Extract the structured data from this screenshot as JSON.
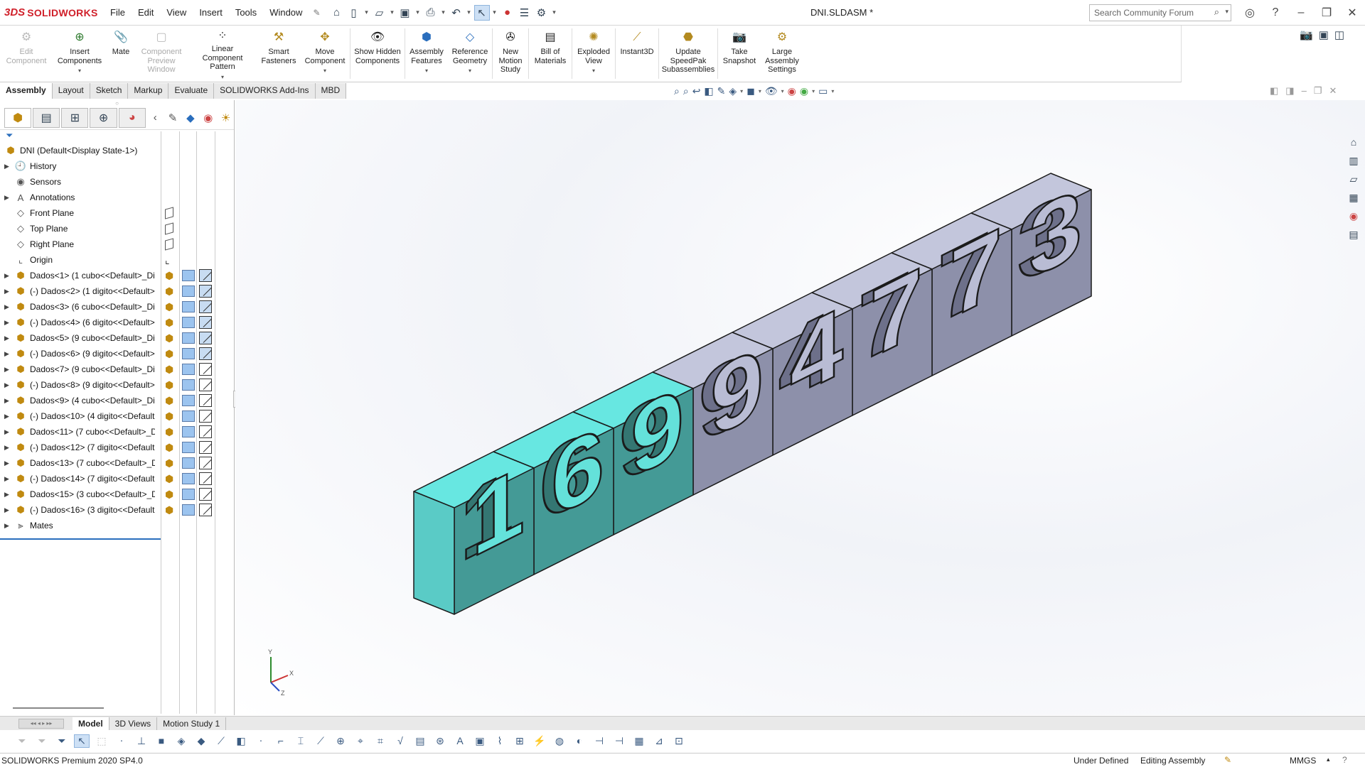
{
  "app": {
    "logo_mark": "3DS",
    "logo_text": "SOLIDWORKS",
    "doc_title": "DNI.SLDASM *",
    "search_placeholder": "Search Community Forum"
  },
  "menu": [
    "File",
    "Edit",
    "View",
    "Insert",
    "Tools",
    "Window"
  ],
  "ribbon": [
    {
      "label": "Edit Component",
      "icon": "edit-component-icon",
      "disabled": true
    },
    {
      "label": "Insert Components",
      "icon": "insert-components-icon",
      "disabled": false,
      "dropdown": true
    },
    {
      "label": "Mate",
      "icon": "mate-icon",
      "disabled": false
    },
    {
      "label": "Component Preview Window",
      "icon": "component-preview-icon",
      "disabled": true
    },
    {
      "label": "Linear Component Pattern",
      "icon": "linear-pattern-icon",
      "disabled": false,
      "dropdown": true
    },
    {
      "label": "Smart Fasteners",
      "icon": "smart-fasteners-icon",
      "disabled": false
    },
    {
      "label": "Move Component",
      "icon": "move-component-icon",
      "disabled": false,
      "dropdown": true
    },
    {
      "label": "Show Hidden Components",
      "icon": "show-hidden-icon",
      "disabled": false
    },
    {
      "label": "Assembly Features",
      "icon": "assembly-features-icon",
      "disabled": false,
      "dropdown": true
    },
    {
      "label": "Reference Geometry",
      "icon": "reference-geometry-icon",
      "disabled": false,
      "dropdown": true
    },
    {
      "label": "New Motion Study",
      "icon": "motion-study-icon",
      "disabled": false
    },
    {
      "label": "Bill of Materials",
      "icon": "bom-icon",
      "disabled": false
    },
    {
      "label": "Exploded View",
      "icon": "exploded-view-icon",
      "disabled": false,
      "dropdown": true
    },
    {
      "label": "Instant3D",
      "icon": "instant3d-icon",
      "disabled": false
    },
    {
      "label": "Update SpeedPak Subassemblies",
      "icon": "speedpak-icon",
      "disabled": false
    },
    {
      "label": "Take Snapshot",
      "icon": "snapshot-icon",
      "disabled": false
    },
    {
      "label": "Large Assembly Settings",
      "icon": "large-assembly-icon",
      "disabled": false
    }
  ],
  "cm_tabs": [
    "Assembly",
    "Layout",
    "Sketch",
    "Markup",
    "Evaluate",
    "SOLIDWORKS Add-Ins",
    "MBD"
  ],
  "cm_active": "Assembly",
  "tree": {
    "root": "DNI  (Default<Display State-1>)",
    "folders": [
      {
        "label": "History",
        "icon": "history-icon",
        "expandable": true
      },
      {
        "label": "Sensors",
        "icon": "sensors-icon",
        "expandable": false
      },
      {
        "label": "Annotations",
        "icon": "annotations-icon",
        "expandable": true
      },
      {
        "label": "Front Plane",
        "icon": "plane-icon",
        "expandable": false
      },
      {
        "label": "Top Plane",
        "icon": "plane-icon",
        "expandable": false
      },
      {
        "label": "Right Plane",
        "icon": "plane-icon",
        "expandable": false
      },
      {
        "label": "Origin",
        "icon": "origin-icon",
        "expandable": false
      }
    ],
    "components": [
      {
        "label": "Dados<1> (1 cubo<<Default>_Di",
        "highlight": true
      },
      {
        "label": "(-) Dados<2> (1 digito<<Default>",
        "highlight": true
      },
      {
        "label": "Dados<3> (6 cubo<<Default>_Di",
        "highlight": true
      },
      {
        "label": "(-) Dados<4> (6 digito<<Default>",
        "highlight": true
      },
      {
        "label": "Dados<5> (9 cubo<<Default>_Di",
        "highlight": true
      },
      {
        "label": "(-) Dados<6> (9 digito<<Default>",
        "highlight": true
      },
      {
        "label": "Dados<7> (9 cubo<<Default>_Di",
        "highlight": false
      },
      {
        "label": "(-) Dados<8> (9 digito<<Default>",
        "highlight": false
      },
      {
        "label": "Dados<9> (4 cubo<<Default>_Di",
        "highlight": false
      },
      {
        "label": "(-) Dados<10> (4 digito<<Default",
        "highlight": false
      },
      {
        "label": "Dados<11> (7 cubo<<Default>_D",
        "highlight": false
      },
      {
        "label": "(-) Dados<12> (7 digito<<Default",
        "highlight": false
      },
      {
        "label": "Dados<13> (7 cubo<<Default>_D",
        "highlight": false
      },
      {
        "label": "(-) Dados<14> (7 digito<<Default",
        "highlight": false
      },
      {
        "label": "Dados<15> (3 cubo<<Default>_D",
        "highlight": false
      },
      {
        "label": "(-) Dados<16> (3 digito<<Default",
        "highlight": false
      }
    ],
    "mates": "Mates"
  },
  "model": {
    "digits": [
      "1",
      "6",
      "9",
      "9",
      "4",
      "7",
      "7",
      "3"
    ],
    "highlighted_count": 3,
    "highlight_color": "#5fd6d0",
    "body_color": "#a4a8c4"
  },
  "bottom_tabs": [
    "Model",
    "3D Views",
    "Motion Study 1"
  ],
  "bottom_active": "Model",
  "status": {
    "version": "SOLIDWORKS Premium 2020 SP4.0",
    "define_state": "Under Defined",
    "mode": "Editing Assembly",
    "units": "MMGS"
  }
}
